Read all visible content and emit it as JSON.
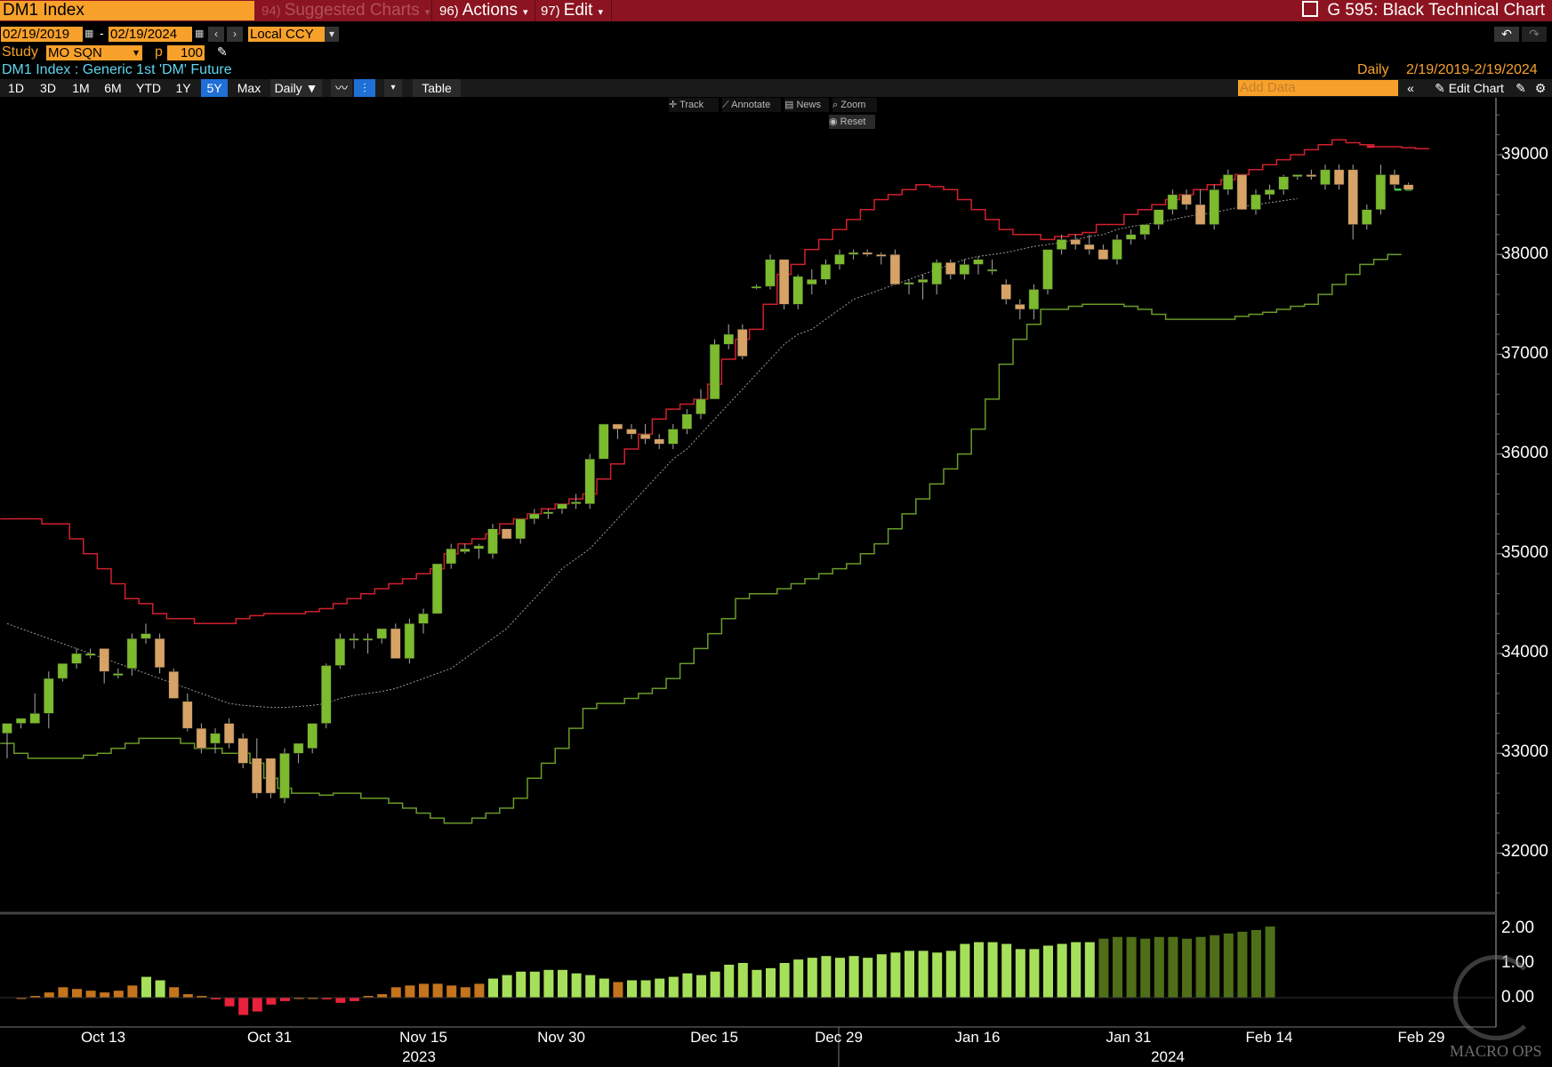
{
  "titlebar": {
    "ticker": "DM1 Index",
    "menus": [
      {
        "num": "94)",
        "label": "Suggested Charts",
        "dim": true
      },
      {
        "num": "96)",
        "label": "Actions",
        "dim": false
      },
      {
        "num": "97)",
        "label": "Edit",
        "dim": false
      }
    ],
    "chart_name": "G 595: Black Technical Chart"
  },
  "range": {
    "start": "02/19/2019",
    "end": "02/19/2024",
    "currency": "Local CCY"
  },
  "study": {
    "label": "Study",
    "value": "MO SQN",
    "p_label": "p",
    "p_value": "100"
  },
  "security_desc": "DM1 Index : Generic 1st 'DM' Future",
  "right_info": {
    "freq": "Daily",
    "range": "2/19/2019-2/19/2024"
  },
  "periods": [
    "1D",
    "3D",
    "1M",
    "6M",
    "YTD",
    "1Y",
    "5Y",
    "Max"
  ],
  "active_period": "5Y",
  "freq_select": "Daily",
  "table_label": "Table",
  "add_data_placeholder": "Add Data",
  "edit_chart_label": "Edit Chart",
  "chart_tools": {
    "track": "Track",
    "annotate": "Annotate",
    "news": "News",
    "zoom": "Zoom",
    "reset": "Reset"
  },
  "watermark": "MACRO OPS",
  "colors": {
    "bull": "#7cba2e",
    "bear": "#d6a266",
    "upper_band": "#d0202e",
    "lower_band": "#6a9a28",
    "ma": "#9a9a9a"
  },
  "chart_data": {
    "type": "candlestick",
    "y_ticks": [
      "39000",
      "38000",
      "37000",
      "36000",
      "35000",
      "34000",
      "33000",
      "32000"
    ],
    "ylim": [
      31500,
      39500
    ],
    "x_ticks": [
      "Oct 13",
      "Oct 31",
      "Nov 15",
      "Nov 30",
      "Dec 15",
      "Dec 29",
      "Jan 16",
      "Jan 31",
      "Feb 14",
      "Feb 29"
    ],
    "x_years": [
      "2023",
      "2024"
    ],
    "indicator_ticks": [
      "2.00",
      "1.00",
      "0.00"
    ],
    "candles": [
      [
        33200,
        33300,
        32950,
        33300
      ],
      [
        33300,
        33300,
        33250,
        33350
      ],
      [
        33300,
        33600,
        33300,
        33400
      ],
      [
        33400,
        33820,
        33250,
        33750
      ],
      [
        33750,
        33900,
        33720,
        33900
      ],
      [
        33900,
        34050,
        33850,
        34000
      ],
      [
        33980,
        34050,
        33950,
        34000
      ],
      [
        34050,
        34050,
        33700,
        33820
      ],
      [
        33780,
        33850,
        33750,
        33800
      ],
      [
        33850,
        34200,
        33780,
        34150
      ],
      [
        34150,
        34300,
        34100,
        34200
      ],
      [
        34150,
        34200,
        33800,
        33860
      ],
      [
        33820,
        33850,
        33550,
        33550
      ],
      [
        33520,
        33600,
        33220,
        33250
      ],
      [
        33250,
        33300,
        33000,
        33050
      ],
      [
        33100,
        33250,
        33000,
        33200
      ],
      [
        33300,
        33350,
        33050,
        33100
      ],
      [
        33150,
        33200,
        32850,
        32900
      ],
      [
        32950,
        33150,
        32550,
        32600
      ],
      [
        32950,
        32950,
        32550,
        32600
      ],
      [
        32550,
        33050,
        32500,
        33000
      ],
      [
        33000,
        33050,
        32900,
        33100
      ],
      [
        33050,
        33300,
        33000,
        33300
      ],
      [
        33300,
        33900,
        33250,
        33880
      ],
      [
        33880,
        34200,
        33850,
        34150
      ],
      [
        34150,
        34200,
        34050,
        34150
      ],
      [
        34150,
        34200,
        34000,
        34150
      ],
      [
        34150,
        34250,
        34100,
        34250
      ],
      [
        34250,
        34300,
        33950,
        33950
      ],
      [
        33950,
        34350,
        33900,
        34300
      ],
      [
        34300,
        34450,
        34200,
        34400
      ],
      [
        34400,
        34900,
        34400,
        34900
      ],
      [
        34900,
        35100,
        34850,
        35050
      ],
      [
        35020,
        35100,
        35000,
        35050
      ],
      [
        35050,
        35100,
        34950,
        35080
      ],
      [
        35000,
        35300,
        34950,
        35250
      ],
      [
        35250,
        35250,
        35150,
        35150
      ],
      [
        35150,
        35350,
        35100,
        35350
      ],
      [
        35350,
        35450,
        35300,
        35400
      ],
      [
        35400,
        35450,
        35350,
        35420
      ],
      [
        35450,
        35500,
        35400,
        35500
      ],
      [
        35500,
        35600,
        35450,
        35520
      ],
      [
        35500,
        36000,
        35450,
        35950
      ],
      [
        35950,
        36300,
        35950,
        36300
      ],
      [
        36300,
        36300,
        36150,
        36250
      ],
      [
        36250,
        36300,
        36150,
        36200
      ],
      [
        36200,
        36300,
        36100,
        36150
      ],
      [
        36150,
        36200,
        36050,
        36100
      ],
      [
        36100,
        36300,
        36050,
        36250
      ],
      [
        36250,
        36450,
        36200,
        36400
      ],
      [
        36400,
        36650,
        36350,
        36550
      ],
      [
        36550,
        37150,
        36550,
        37100
      ],
      [
        37100,
        37300,
        37050,
        37200
      ],
      [
        37250,
        37300,
        36950,
        36980
      ],
      [
        37680,
        37700,
        37650,
        37680
      ],
      [
        37680,
        38000,
        37650,
        37950
      ],
      [
        37950,
        37950,
        37450,
        37500
      ],
      [
        37500,
        37800,
        37450,
        37780
      ],
      [
        37700,
        37850,
        37600,
        37750
      ],
      [
        37750,
        37950,
        37700,
        37900
      ],
      [
        37900,
        38050,
        37850,
        38000
      ],
      [
        38000,
        38050,
        37950,
        38020
      ],
      [
        38020,
        38050,
        37980,
        38000
      ],
      [
        38000,
        38020,
        37900,
        37980
      ],
      [
        38000,
        38050,
        37700,
        37700
      ],
      [
        37700,
        37750,
        37600,
        37720
      ],
      [
        37720,
        37800,
        37550,
        37750
      ],
      [
        37700,
        37950,
        37600,
        37920
      ],
      [
        37920,
        37950,
        37750,
        37800
      ],
      [
        37800,
        37950,
        37750,
        37900
      ],
      [
        37900,
        37980,
        37800,
        37950
      ],
      [
        37850,
        37950,
        37800,
        37850
      ],
      [
        37700,
        37750,
        37500,
        37550
      ],
      [
        37500,
        37550,
        37350,
        37450
      ],
      [
        37450,
        37700,
        37350,
        37650
      ],
      [
        37650,
        38050,
        37600,
        38050
      ],
      [
        38050,
        38200,
        38000,
        38150
      ],
      [
        38150,
        38200,
        38050,
        38100
      ],
      [
        38100,
        38200,
        38000,
        38050
      ],
      [
        38050,
        38100,
        37950,
        37950
      ],
      [
        37950,
        38200,
        37900,
        38150
      ],
      [
        38150,
        38250,
        38100,
        38200
      ],
      [
        38200,
        38300,
        38150,
        38300
      ],
      [
        38300,
        38450,
        38250,
        38450
      ],
      [
        38450,
        38650,
        38400,
        38600
      ],
      [
        38600,
        38650,
        38450,
        38500
      ],
      [
        38500,
        38650,
        38300,
        38300
      ],
      [
        38300,
        38700,
        38250,
        38650
      ],
      [
        38650,
        38850,
        38600,
        38800
      ],
      [
        38800,
        38800,
        38500,
        38450
      ],
      [
        38450,
        38650,
        38400,
        38600
      ],
      [
        38600,
        38700,
        38550,
        38650
      ],
      [
        38650,
        38800,
        38600,
        38780
      ],
      [
        38780,
        38800,
        38750,
        38800
      ],
      [
        38800,
        38850,
        38750,
        38780
      ],
      [
        38700,
        38900,
        38650,
        38850
      ],
      [
        38850,
        38900,
        38650,
        38700
      ],
      [
        38850,
        38900,
        38150,
        38300
      ],
      [
        38300,
        38500,
        38250,
        38450
      ],
      [
        38450,
        38900,
        38400,
        38800
      ],
      [
        38800,
        38850,
        38650,
        38700
      ],
      [
        38700,
        38720,
        38650,
        38650
      ]
    ],
    "upper_band": [
      35350,
      35350,
      35350,
      35300,
      35300,
      35150,
      35000,
      34850,
      34700,
      34550,
      34500,
      34400,
      34350,
      34350,
      34300,
      34300,
      34300,
      34350,
      34380,
      34400,
      34400,
      34400,
      34420,
      34450,
      34500,
      34550,
      34600,
      34650,
      34700,
      34750,
      34800,
      34850,
      35000,
      35100,
      35150,
      35200,
      35300,
      35350,
      35400,
      35450,
      35500,
      35550,
      35600,
      35750,
      35900,
      36050,
      36200,
      36350,
      36450,
      36500,
      36550,
      36700,
      36950,
      37150,
      37250,
      37500,
      37800,
      37900,
      38050,
      38150,
      38250,
      38350,
      38450,
      38550,
      38600,
      38650,
      38700,
      38680,
      38650,
      38550,
      38450,
      38350,
      38250,
      38200,
      38200,
      38150,
      38180,
      38200,
      38220,
      38300,
      38300,
      38400,
      38450,
      38500,
      38550,
      38600,
      38650,
      38700,
      38750,
      38800,
      38850,
      38900,
      38950,
      39000,
      39050,
      39100,
      39150,
      39120,
      39100,
      39080,
      39080,
      39070,
      39060
    ],
    "lower_band": [
      33100,
      33000,
      32950,
      32950,
      32950,
      32950,
      32980,
      33000,
      33050,
      33100,
      33150,
      33150,
      33150,
      33100,
      33050,
      33050,
      33000,
      33000,
      32900,
      32750,
      32650,
      32600,
      32600,
      32580,
      32600,
      32600,
      32550,
      32550,
      32500,
      32450,
      32400,
      32350,
      32300,
      32300,
      32350,
      32400,
      32450,
      32550,
      32750,
      32900,
      33050,
      33250,
      33450,
      33500,
      33500,
      33550,
      33600,
      33650,
      33750,
      33900,
      34050,
      34200,
      34350,
      34550,
      34600,
      34600,
      34650,
      34700,
      34750,
      34800,
      34850,
      34900,
      35000,
      35100,
      35250,
      35400,
      35550,
      35700,
      35850,
      36000,
      36250,
      36550,
      36900,
      37150,
      37300,
      37450,
      37450,
      37480,
      37500,
      37500,
      37500,
      37480,
      37450,
      37400,
      37350,
      37350,
      37350,
      37350,
      37350,
      37380,
      37400,
      37420,
      37450,
      37480,
      37500,
      37600,
      37700,
      37800,
      37900,
      37950,
      38000
    ],
    "ma": [
      34300,
      34250,
      34200,
      34150,
      34100,
      34050,
      34000,
      33950,
      33900,
      33850,
      33800,
      33750,
      33700,
      33650,
      33600,
      33550,
      33500,
      33480,
      33470,
      33460,
      33460,
      33470,
      33480,
      33500,
      33550,
      33580,
      33600,
      33620,
      33650,
      33700,
      33750,
      33800,
      33850,
      33950,
      34050,
      34150,
      34250,
      34400,
      34550,
      34700,
      34850,
      34950,
      35050,
      35200,
      35350,
      35500,
      35650,
      35800,
      35950,
      36050,
      36200,
      36350,
      36500,
      36650,
      36800,
      36950,
      37100,
      37200,
      37250,
      37350,
      37450,
      37550,
      37600,
      37650,
      37700,
      37750,
      37800,
      37850,
      37900,
      37950,
      37980,
      38000,
      38020,
      38050,
      38080,
      38100,
      38120,
      38150,
      38180,
      38200,
      38250,
      38280,
      38300,
      38320,
      38350,
      38380,
      38400,
      38420,
      38450,
      38480,
      38500,
      38520,
      38540,
      38560
    ],
    "upper_dash": 39080,
    "lower_dash": 38650,
    "indicator": [
      0.0,
      0.05,
      0.15,
      0.3,
      0.25,
      0.2,
      0.15,
      0.2,
      0.35,
      0.6,
      0.5,
      0.3,
      0.1,
      0.05,
      -0.05,
      -0.25,
      -0.5,
      -0.4,
      -0.2,
      -0.1,
      0.0,
      0.0,
      -0.05,
      -0.15,
      -0.1,
      0.05,
      0.1,
      0.3,
      0.35,
      0.4,
      0.4,
      0.35,
      0.3,
      0.4,
      0.55,
      0.65,
      0.75,
      0.75,
      0.8,
      0.8,
      0.7,
      0.65,
      0.55,
      0.45,
      0.5,
      0.5,
      0.55,
      0.6,
      0.7,
      0.65,
      0.75,
      0.95,
      1.0,
      0.8,
      0.85,
      1.0,
      1.1,
      1.15,
      1.2,
      1.15,
      1.2,
      1.15,
      1.25,
      1.3,
      1.35,
      1.35,
      1.3,
      1.35,
      1.55,
      1.6,
      1.6,
      1.55,
      1.4,
      1.4,
      1.5,
      1.55,
      1.6,
      1.6,
      1.7,
      1.75,
      1.75,
      1.7,
      1.75,
      1.75,
      1.7,
      1.75,
      1.8,
      1.85,
      1.9,
      1.95,
      2.05
    ]
  }
}
